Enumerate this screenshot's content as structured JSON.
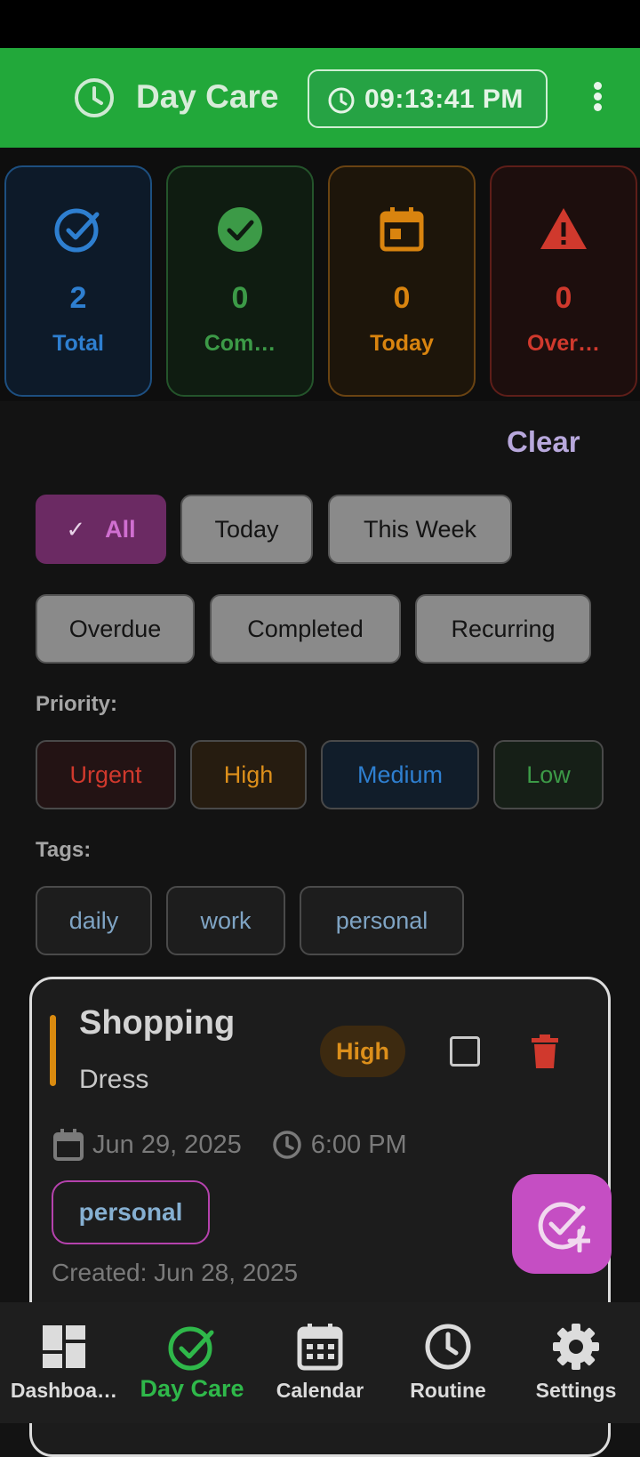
{
  "header": {
    "title": "Day Care",
    "time": "09:13:41 PM",
    "icons": [
      "clock-icon",
      "more-vert-icon"
    ]
  },
  "stats": [
    {
      "value": "2",
      "label": "Total",
      "color": "#2e7fd0",
      "icon": "check-circle-outline-icon"
    },
    {
      "value": "0",
      "label": "Com…",
      "color": "#3c9a47",
      "icon": "check-circle-filled-icon"
    },
    {
      "value": "0",
      "label": "Today",
      "color": "#d9840f",
      "icon": "calendar-today-icon"
    },
    {
      "value": "0",
      "label": "Over…",
      "color": "#d0392d",
      "icon": "warning-icon"
    }
  ],
  "filters": {
    "clear_label": "Clear",
    "status": [
      "All",
      "Today",
      "This Week",
      "Overdue",
      "Completed",
      "Recurring"
    ],
    "selected": "All",
    "priority_heading": "Priority:",
    "priorities": [
      {
        "label": "Urgent",
        "color": "#d0392d"
      },
      {
        "label": "High",
        "color": "#dc8f1b"
      },
      {
        "label": "Medium",
        "color": "#2e7fd0"
      },
      {
        "label": "Low",
        "color": "#3c9a47"
      }
    ],
    "tags_heading": "Tags:",
    "tags": [
      "daily",
      "work",
      "personal"
    ]
  },
  "task": {
    "title": "Shopping",
    "description": "Dress",
    "priority": "High",
    "completed": false,
    "date": "Jun 29, 2025",
    "time": "6:00 PM",
    "tag": "personal",
    "created": "Created: Jun 28, 2025"
  },
  "fab": {
    "icon": "add-task-icon"
  },
  "nav": {
    "items": [
      "Dashboa…",
      "Day Care",
      "Calendar",
      "Routine",
      "Settings"
    ],
    "active": "Day Care"
  }
}
